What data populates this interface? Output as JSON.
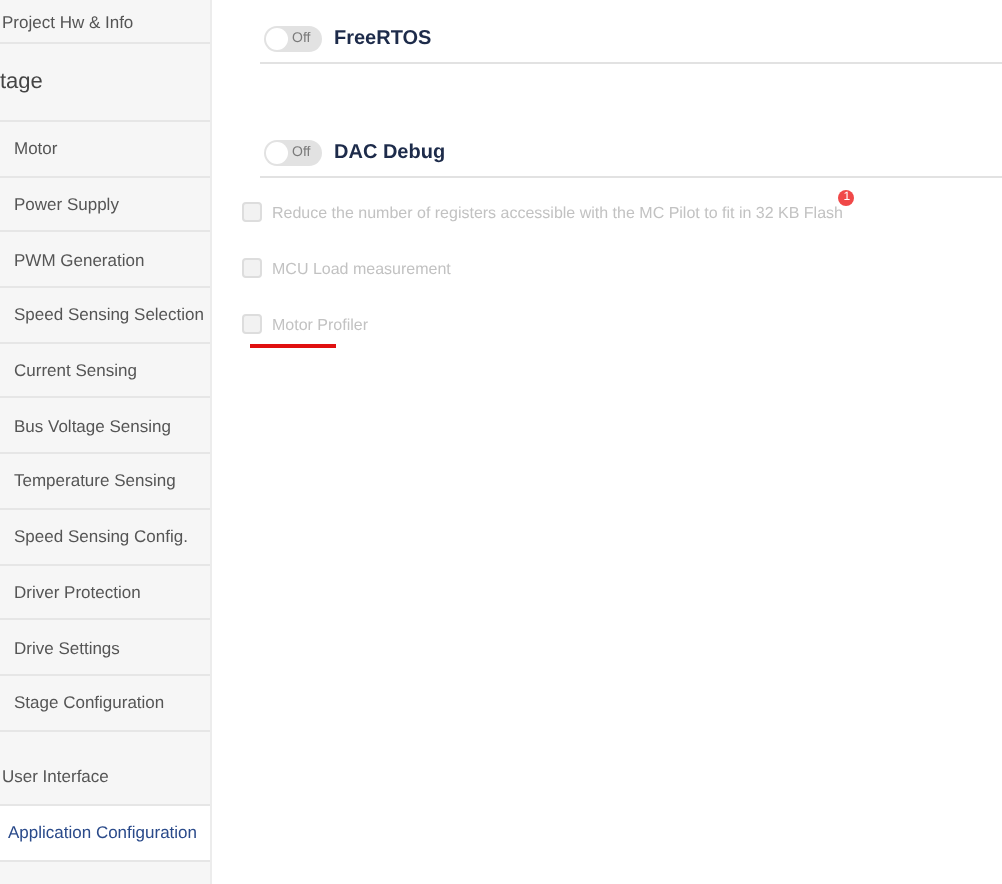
{
  "sidebar": {
    "items": [
      {
        "kind": "item",
        "label": "Project Hw & Info",
        "selected": false
      },
      {
        "kind": "section",
        "label": "tage",
        "children": [
          {
            "label": "Motor",
            "selected": false
          },
          {
            "label": "Power Supply",
            "selected": false
          },
          {
            "label": "PWM Generation",
            "selected": false
          },
          {
            "label": "Speed Sensing Selection",
            "selected": false
          },
          {
            "label": "Current Sensing",
            "selected": false
          },
          {
            "label": "Bus Voltage Sensing",
            "selected": false
          },
          {
            "label": "Temperature Sensing",
            "selected": false
          },
          {
            "label": "Speed Sensing Config.",
            "selected": false
          },
          {
            "label": "Driver Protection",
            "selected": false
          },
          {
            "label": "Drive Settings",
            "selected": false
          },
          {
            "label": "Stage Configuration",
            "selected": false
          }
        ]
      },
      {
        "kind": "item",
        "label": "User Interface",
        "selected": false
      },
      {
        "kind": "item",
        "label": "Application Configuration",
        "selected": true
      }
    ]
  },
  "toggles": [
    {
      "label": "FreeRTOS",
      "on": false,
      "state_text": "Off"
    },
    {
      "label": "DAC Debug",
      "on": false,
      "state_text": "Off"
    }
  ],
  "options": [
    {
      "label": "Reduce the number of registers accessible with the MC Pilot to fit in 32 KB Flash",
      "checked": false,
      "disabled": true,
      "badge": "1"
    },
    {
      "label": "MCU Load measurement",
      "checked": false,
      "disabled": true
    },
    {
      "label": "Motor Profiler",
      "checked": false,
      "disabled": true,
      "highlighted": true
    }
  ]
}
